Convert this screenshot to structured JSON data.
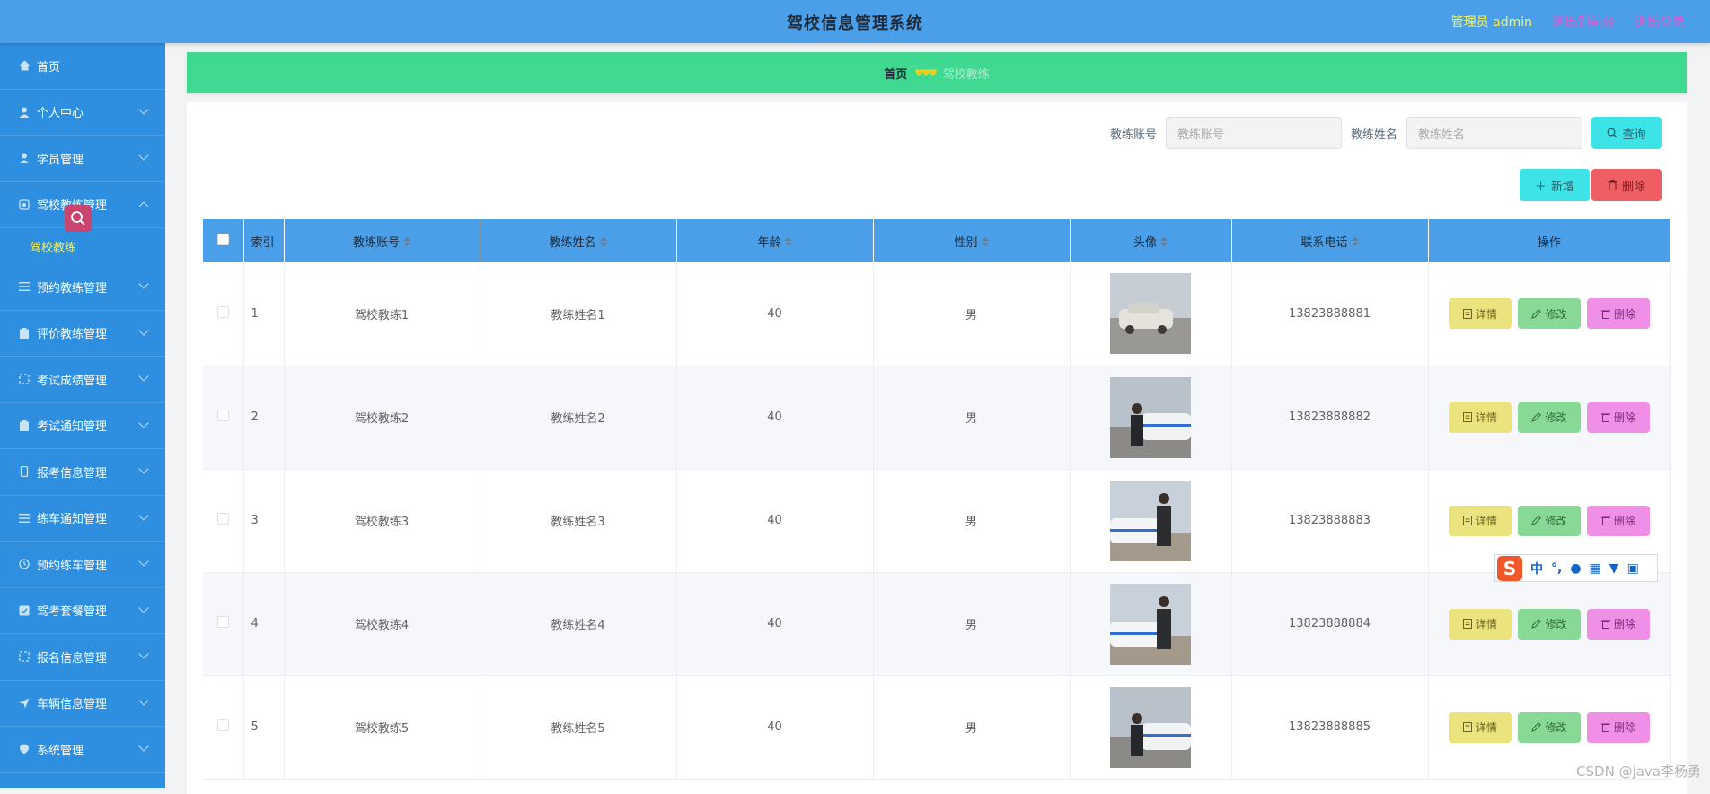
{
  "header": {
    "title": "驾校信息管理系统",
    "admin_label": "管理员 admin",
    "back_label": "退出到前台",
    "logout_label": "退出登录"
  },
  "sidebar": {
    "items": [
      {
        "label": "首页",
        "icon": "home-icon"
      },
      {
        "label": "个人中心",
        "icon": "user-icon"
      },
      {
        "label": "学员管理",
        "icon": "user-icon"
      },
      {
        "label": "驾校教练管理",
        "icon": "setting-icon",
        "expanded": true
      },
      {
        "label": "预约教练管理",
        "icon": "list-icon"
      },
      {
        "label": "评价教练管理",
        "icon": "clipboard-icon"
      },
      {
        "label": "考试成绩管理",
        "icon": "crop-icon"
      },
      {
        "label": "考试通知管理",
        "icon": "clipboard-icon"
      },
      {
        "label": "报考信息管理",
        "icon": "phone-icon"
      },
      {
        "label": "练车通知管理",
        "icon": "list-icon"
      },
      {
        "label": "预约练车管理",
        "icon": "clock-icon"
      },
      {
        "label": "驾考套餐管理",
        "icon": "check-icon"
      },
      {
        "label": "报名信息管理",
        "icon": "crop-icon"
      },
      {
        "label": "车辆信息管理",
        "icon": "send-icon"
      },
      {
        "label": "系统管理",
        "icon": "location-icon"
      }
    ],
    "sub_item": "驾校教练"
  },
  "breadcrumb": {
    "home": "首页",
    "current": "驾校教练"
  },
  "search": {
    "account_label": "教练账号",
    "account_placeholder": "教练账号",
    "name_label": "教练姓名",
    "name_placeholder": "教练姓名",
    "query_label": "查询"
  },
  "actions": {
    "add_label": "新增",
    "delete_label": "删除"
  },
  "table": {
    "columns": [
      "索引",
      "教练账号",
      "教练姓名",
      "年龄",
      "性别",
      "头像",
      "联系电话",
      "操作"
    ],
    "rows": [
      {
        "index": "1",
        "account": "驾校教练1",
        "name": "教练姓名1",
        "age": "40",
        "gender": "男",
        "phone": "13823888881"
      },
      {
        "index": "2",
        "account": "驾校教练2",
        "name": "教练姓名2",
        "age": "40",
        "gender": "男",
        "phone": "13823888882"
      },
      {
        "index": "3",
        "account": "驾校教练3",
        "name": "教练姓名3",
        "age": "40",
        "gender": "男",
        "phone": "13823888883"
      },
      {
        "index": "4",
        "account": "驾校教练4",
        "name": "教练姓名4",
        "age": "40",
        "gender": "男",
        "phone": "13823888884"
      },
      {
        "index": "5",
        "account": "驾校教练5",
        "name": "教练姓名5",
        "age": "40",
        "gender": "男",
        "phone": "13823888885"
      }
    ],
    "row_actions": {
      "detail": "详情",
      "edit": "修改",
      "delete": "删除"
    }
  },
  "ime_toolbar": {
    "mode": "中"
  },
  "watermark": "CSDN @java李杨勇",
  "colors": {
    "header": "#4a9fe8",
    "sidebar": "#2e8fe0",
    "breadcrumb": "#3fd992",
    "accent_yellow": "#f5f36b"
  }
}
